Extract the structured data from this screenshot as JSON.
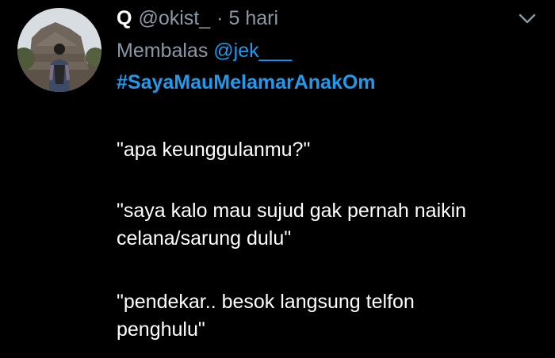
{
  "tweet": {
    "display_name": "Q",
    "handle": "@okist_",
    "separator": "·",
    "time": "5 hari",
    "reply_prefix": "Membalas",
    "reply_to": "@jek___",
    "hashtag": "#SayaMauMelamarAnakOm",
    "body": {
      "line1": "\"apa keunggulanmu?\"",
      "line2": "\"saya kalo mau sujud gak pernah naikin",
      "line3": "celana/sarung dulu\"",
      "line4": "\"pendekar.. besok langsung telfon",
      "line5": "penghulu\""
    }
  },
  "icons": {
    "avatar": "user-avatar",
    "menu": "chevron-down-icon"
  },
  "colors": {
    "background": "#000000",
    "text": "#ffffff",
    "secondary": "#8b98a5",
    "link": "#1d9bf0"
  }
}
